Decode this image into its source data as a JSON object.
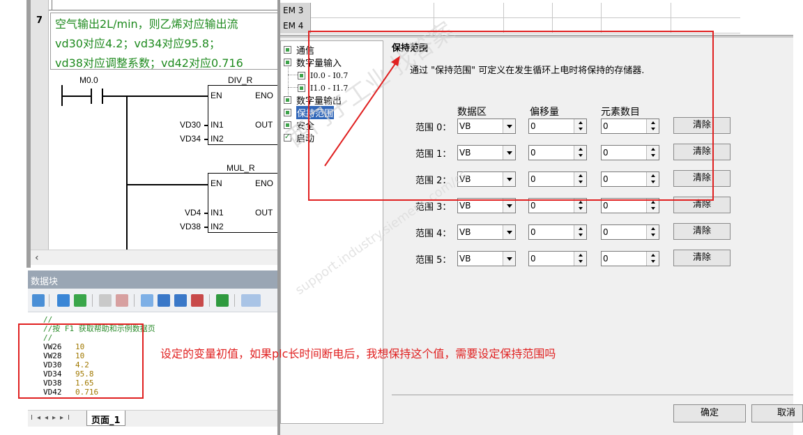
{
  "ladder": {
    "network_number": "7",
    "comment_lines": [
      "空气输出2L/min，则乙烯对应输出流",
      "vd30对应4.2；vd34对应95.8；",
      "vd38对应调整系数；vd42对应0.716"
    ],
    "contact": "M0.0",
    "div_block": {
      "name": "DIV_R",
      "en": "EN",
      "eno": "ENO",
      "in1": "IN1",
      "in2": "IN2",
      "out": "OUT",
      "in1_var": "VD30",
      "in2_var": "VD34"
    },
    "mul_block": {
      "name": "MUL_R",
      "en": "EN",
      "eno": "ENO",
      "in1": "IN1",
      "in2": "IN2",
      "out": "OUT",
      "in1_var": "VD4",
      "in2_var": "VD38"
    }
  },
  "data_block": {
    "title": "数据块",
    "comment1": "//",
    "comment2": "//按 F1 获取帮助和示例数据页",
    "comment3": "//",
    "rows": [
      {
        "addr": "VW26",
        "value": "10"
      },
      {
        "addr": "VW28",
        "value": "10"
      },
      {
        "addr": "VD30",
        "value": "4.2"
      },
      {
        "addr": "VD34",
        "value": "95.8"
      },
      {
        "addr": "VD38",
        "value": "1.65"
      },
      {
        "addr": "VD42",
        "value": "0.716"
      }
    ],
    "tab_label": "页面_1"
  },
  "em_table": {
    "rows": [
      "EM 3",
      "EM 4"
    ]
  },
  "tree": {
    "items": [
      {
        "label": "通信",
        "checked": false
      },
      {
        "label": "数字量输入",
        "checked": false
      },
      {
        "label": "I0.0 - I0.7",
        "checked": false
      },
      {
        "label": "I1.0 - I1.7",
        "checked": false
      },
      {
        "label": "数字量输出",
        "checked": false
      },
      {
        "label": "保持范围",
        "checked": false
      },
      {
        "label": "安全",
        "checked": false
      },
      {
        "label": "启动",
        "checked": true
      }
    ]
  },
  "retentive": {
    "title": "保持范围",
    "description": "通过 \"保持范围\" 可定义在发生循环上电时将保持的存储器.",
    "headers": {
      "area": "数据区",
      "offset": "偏移量",
      "count": "元素数目"
    },
    "ranges": [
      {
        "label": "范围 0：",
        "area": "VB",
        "offset": "0",
        "count": "0",
        "clear": "清除"
      },
      {
        "label": "范围 1：",
        "area": "VB",
        "offset": "0",
        "count": "0",
        "clear": "清除"
      },
      {
        "label": "范围 2：",
        "area": "VB",
        "offset": "0",
        "count": "0",
        "clear": "清除"
      },
      {
        "label": "范围 3：",
        "area": "VB",
        "offset": "0",
        "count": "0",
        "clear": "清除"
      },
      {
        "label": "范围 4：",
        "area": "VB",
        "offset": "0",
        "count": "0",
        "clear": "清除"
      },
      {
        "label": "范围 5：",
        "area": "VB",
        "offset": "0",
        "count": "0",
        "clear": "清除"
      }
    ],
    "ok": "确定",
    "cancel": "取消"
  },
  "annotation": {
    "question": "设定的变量初值，如果plc长时间断电后，我想保持这个值，需要设定保持范围吗",
    "color": "#e02020"
  },
  "watermark": {
    "line1": "西门子工业 找答案",
    "line2": "support.industry.siemens.com/cs"
  }
}
